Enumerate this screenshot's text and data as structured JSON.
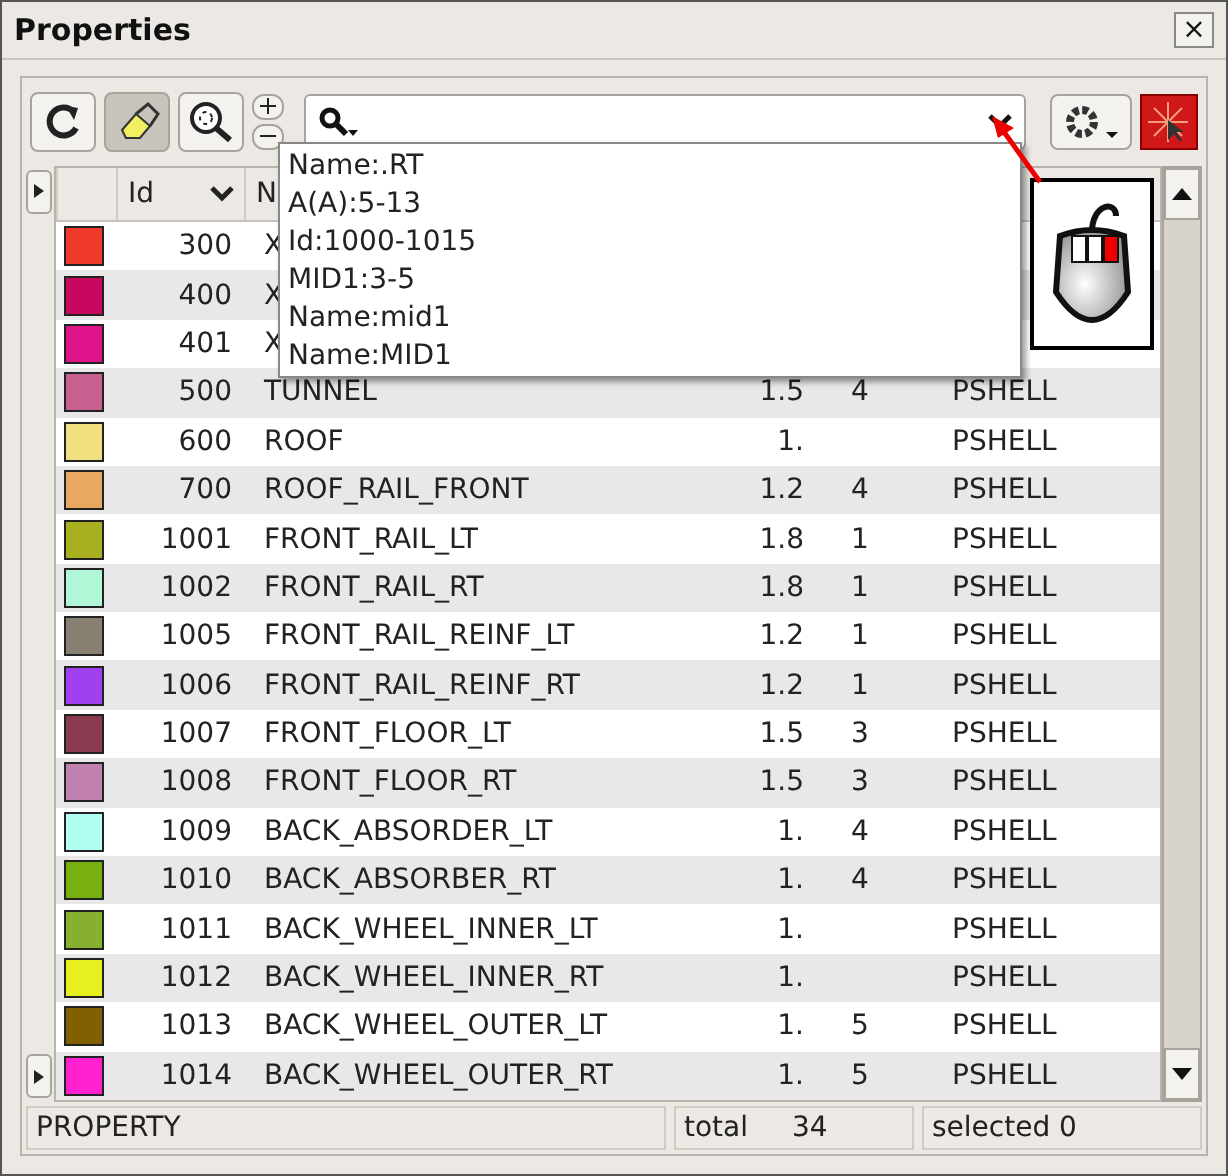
{
  "window": {
    "title": "Properties",
    "close": "×"
  },
  "toolbar": {
    "highlight_on": true
  },
  "popup": {
    "items": [
      "Name:.RT",
      "A(A):5-13",
      "Id:1000-1015",
      "MID1:3-5",
      "Name:mid1",
      "Name:MID1"
    ]
  },
  "table": {
    "columns": [
      "Id",
      "N"
    ],
    "rows": [
      {
        "color": "#f03a2a",
        "id": "300",
        "name": "X"
      },
      {
        "color": "#c8085f",
        "id": "400",
        "name": "X"
      },
      {
        "color": "#e0148a",
        "id": "401",
        "name": "X"
      },
      {
        "color": "#c86090",
        "id": "500",
        "name": "TUNNEL",
        "thickness": "1.5",
        "mid": "4",
        "type": "PSHELL"
      },
      {
        "color": "#f0e080",
        "id": "600",
        "name": "ROOF",
        "thickness": "1.",
        "type": "PSHELL"
      },
      {
        "color": "#e8a860",
        "id": "700",
        "name": "ROOF_RAIL_FRONT",
        "thickness": "1.2",
        "mid": "4",
        "type": "PSHELL"
      },
      {
        "color": "#a8b020",
        "id": "1001",
        "name": "FRONT_RAIL_LT",
        "thickness": "1.8",
        "mid": "1",
        "type": "PSHELL"
      },
      {
        "color": "#b0f8d8",
        "id": "1002",
        "name": "FRONT_RAIL_RT",
        "thickness": "1.8",
        "mid": "1",
        "type": "PSHELL"
      },
      {
        "color": "#888070",
        "id": "1005",
        "name": "FRONT_RAIL_REINF_LT",
        "thickness": "1.2",
        "mid": "1",
        "type": "PSHELL"
      },
      {
        "color": "#a040f0",
        "id": "1006",
        "name": "FRONT_RAIL_REINF_RT",
        "thickness": "1.2",
        "mid": "1",
        "type": "PSHELL"
      },
      {
        "color": "#8c3a50",
        "id": "1007",
        "name": "FRONT_FLOOR_LT",
        "thickness": "1.5",
        "mid": "3",
        "type": "PSHELL"
      },
      {
        "color": "#c080b0",
        "id": "1008",
        "name": "FRONT_FLOOR_RT",
        "thickness": "1.5",
        "mid": "3",
        "type": "PSHELL"
      },
      {
        "color": "#b0fff0",
        "id": "1009",
        "name": "BACK_ABSORDER_LT",
        "thickness": "1.",
        "mid": "4",
        "type": "PSHELL"
      },
      {
        "color": "#78b010",
        "id": "1010",
        "name": "BACK_ABSORBER_RT",
        "thickness": "1.",
        "mid": "4",
        "type": "PSHELL"
      },
      {
        "color": "#88b030",
        "id": "1011",
        "name": "BACK_WHEEL_INNER_LT",
        "thickness": "1.",
        "type": "PSHELL"
      },
      {
        "color": "#e8f020",
        "id": "1012",
        "name": "BACK_WHEEL_INNER_RT",
        "thickness": "1.",
        "type": "PSHELL"
      },
      {
        "color": "#806000",
        "id": "1013",
        "name": "BACK_WHEEL_OUTER_LT",
        "thickness": "1.",
        "mid": "5",
        "type": "PSHELL"
      },
      {
        "color": "#ff20d0",
        "id": "1014",
        "name": "BACK_WHEEL_OUTER_RT",
        "thickness": "1.",
        "mid": "5",
        "type": "PSHELL"
      }
    ]
  },
  "status_bar": {
    "label": "PROPERTY",
    "total_label": "total",
    "total": "34",
    "selected": "selected 0"
  }
}
